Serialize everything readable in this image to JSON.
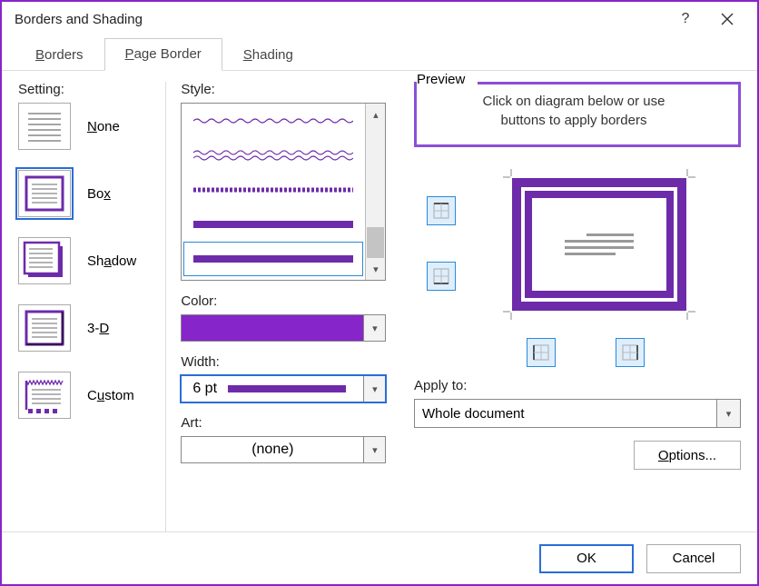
{
  "window": {
    "title": "Borders and Shading"
  },
  "tabs": {
    "borders": "Borders",
    "page_border": "Page Border",
    "shading": "Shading",
    "active": "page_border"
  },
  "setting": {
    "label": "Setting:",
    "items": [
      {
        "id": "none",
        "label": "None"
      },
      {
        "id": "box",
        "label": "Box"
      },
      {
        "id": "shadow",
        "label": "Shadow"
      },
      {
        "id": "3d",
        "label": "3-D"
      },
      {
        "id": "custom",
        "label": "Custom"
      }
    ],
    "selected": "box"
  },
  "style": {
    "label": "Style:"
  },
  "color": {
    "label": "Color:",
    "value": "#8625c9"
  },
  "width": {
    "label": "Width:",
    "value": "6 pt"
  },
  "art": {
    "label": "Art:",
    "value": "(none)"
  },
  "preview": {
    "label": "Preview",
    "hint_line1": "Click on diagram below or use",
    "hint_line2": "buttons to apply borders",
    "apply_label": "Apply to:",
    "apply_value": "Whole document",
    "options": "Options..."
  },
  "footer": {
    "ok": "OK",
    "cancel": "Cancel"
  }
}
